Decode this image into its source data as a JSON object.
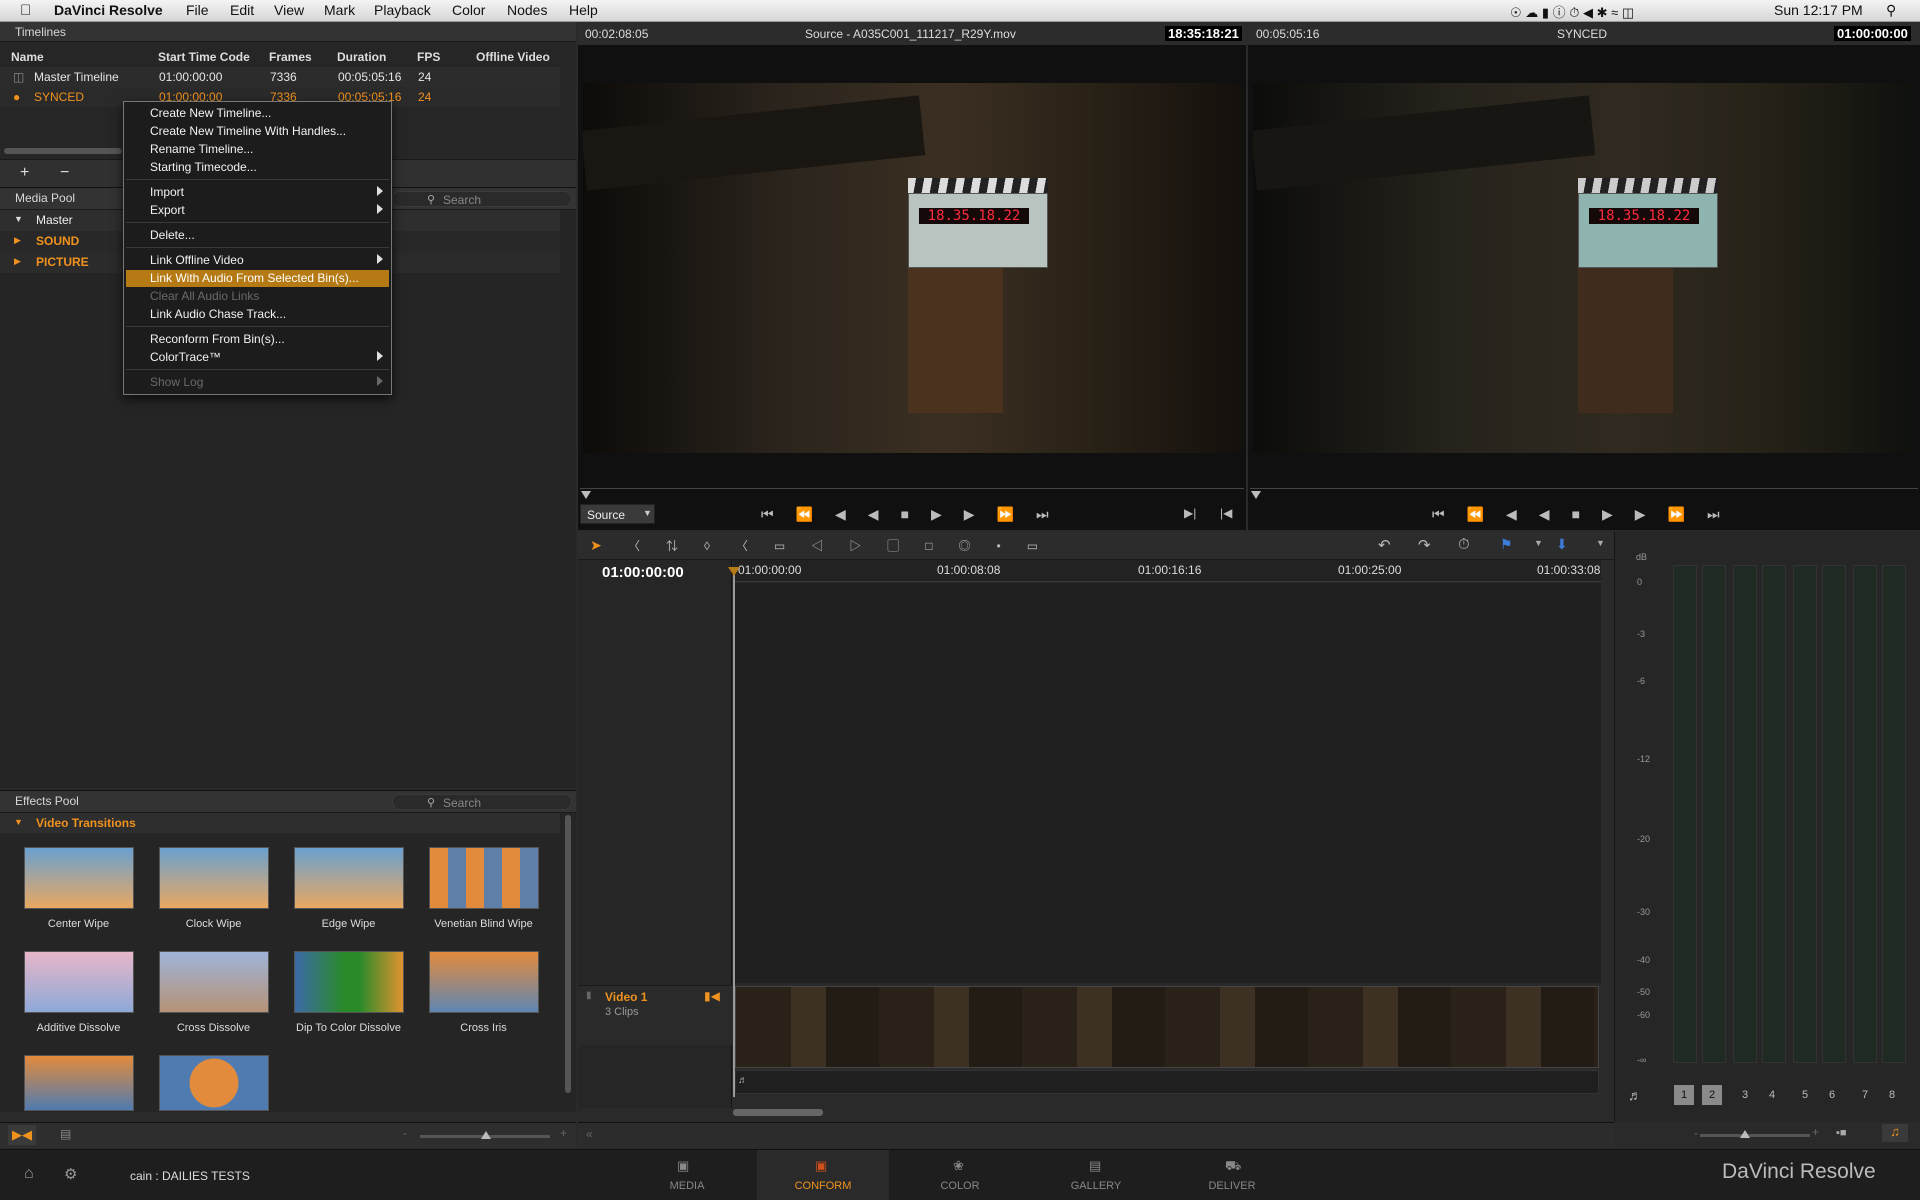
{
  "menubar": {
    "app_name": "DaVinci Resolve",
    "menus": [
      "File",
      "Edit",
      "View",
      "Mark",
      "Playback",
      "Color",
      "Nodes",
      "Help"
    ],
    "clock": "Sun 12:17 PM"
  },
  "timelines": {
    "title": "Timelines",
    "columns": [
      "Name",
      "Start Time Code",
      "Frames",
      "Duration",
      "FPS",
      "Offline Video"
    ],
    "rows": [
      {
        "name": "Master Timeline",
        "start": "01:00:00:00",
        "frames": "7336",
        "duration": "00:05:05:16",
        "fps": "24"
      },
      {
        "name": "SYNCED",
        "start": "01:00:00:00",
        "frames": "7336",
        "duration": "00:05:05:16",
        "fps": "24"
      }
    ],
    "add_label": "+",
    "remove_label": "−"
  },
  "context_menu": {
    "items": [
      {
        "label": "Create New Timeline...",
        "enabled": true
      },
      {
        "label": "Create New Timeline With Handles...",
        "enabled": true
      },
      {
        "label": "Rename Timeline...",
        "enabled": true
      },
      {
        "label": "Starting Timecode...",
        "enabled": true
      },
      {
        "label": "Import",
        "enabled": true,
        "submenu": true
      },
      {
        "label": "Export",
        "enabled": true,
        "submenu": true
      },
      {
        "label": "Delete...",
        "enabled": true
      },
      {
        "label": "Link Offline Video",
        "enabled": true,
        "submenu": true
      },
      {
        "label": "Link With Audio From Selected Bin(s)...",
        "enabled": true,
        "highlighted": true
      },
      {
        "label": "Clear All Audio Links",
        "enabled": false
      },
      {
        "label": "Link Audio Chase Track...",
        "enabled": true
      },
      {
        "label": "Reconform From Bin(s)...",
        "enabled": true
      },
      {
        "label": "ColorTrace™",
        "enabled": true,
        "submenu": true
      },
      {
        "label": "Show Log",
        "enabled": false,
        "submenu": true
      }
    ]
  },
  "media_pool": {
    "title": "Media Pool",
    "search_placeholder": "Search",
    "bins": [
      "Master",
      "SOUND",
      "PICTURE"
    ]
  },
  "effects_pool": {
    "title": "Effects Pool",
    "search_placeholder": "Search",
    "category": "Video Transitions",
    "effects": [
      "Center Wipe",
      "Clock Wipe",
      "Edge Wipe",
      "Venetian Blind Wipe",
      "Additive Dissolve",
      "Cross Dissolve",
      "Dip To Color Dissolve",
      "Cross Iris",
      "",
      ""
    ]
  },
  "source_viewer": {
    "timecode_left": "00:02:08:05",
    "title": "Source - A035C001_111217_R29Y.mov",
    "timecode_right": "18:35:18:21",
    "mode": "Source",
    "slate_display": "18.35.18.22"
  },
  "record_viewer": {
    "timecode_left": "00:05:05:16",
    "title": "SYNCED",
    "timecode_right": "01:00:00:00",
    "slate_display": "18.35.18.22"
  },
  "timeline": {
    "current_tc": "01:00:00:00",
    "ruler": [
      "01:00:00:00",
      "01:00:08:08",
      "01:00:16:16",
      "01:00:25:00",
      "01:00:33:08"
    ],
    "track_name": "Video 1",
    "track_clips": "3 Clips"
  },
  "audio_meters": {
    "db_label": "dB",
    "scale": [
      "0",
      "-3",
      "-6",
      "-12",
      "-20",
      "-30",
      "-40",
      "-50",
      "-60",
      "-∞"
    ],
    "channels": [
      "1",
      "2",
      "3",
      "4",
      "5",
      "6",
      "7",
      "8"
    ]
  },
  "status": {
    "project": "cain : DAILIES TESTS",
    "brand": "DaVinci Resolve"
  },
  "tabs": [
    "MEDIA",
    "CONFORM",
    "COLOR",
    "GALLERY",
    "DELIVER"
  ],
  "active_tab": "CONFORM"
}
